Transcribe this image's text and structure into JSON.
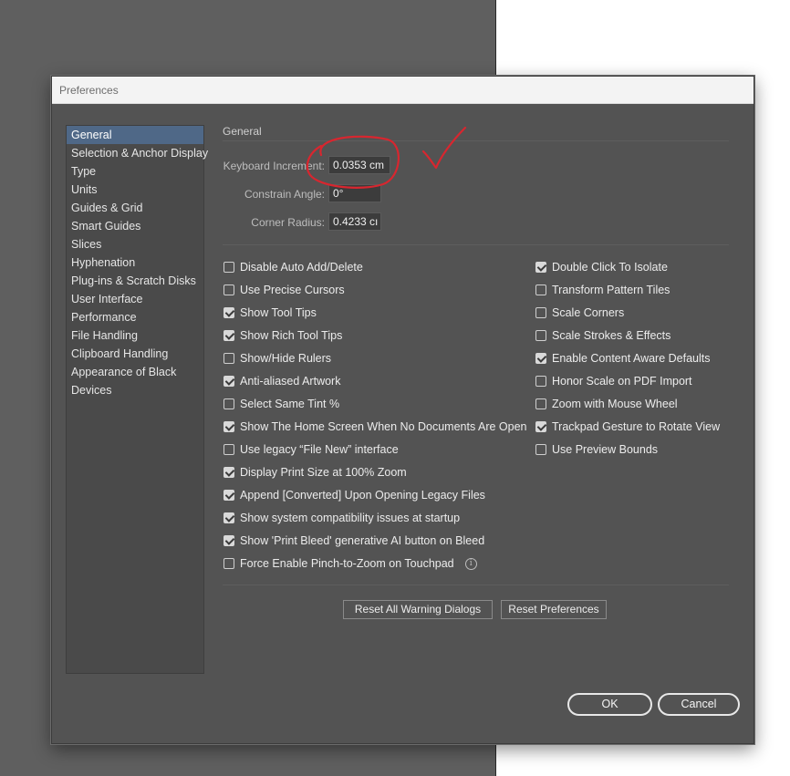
{
  "window": {
    "title": "Preferences"
  },
  "sidebar": {
    "items": [
      {
        "label": "General",
        "active": true
      },
      {
        "label": "Selection & Anchor Display"
      },
      {
        "label": "Type"
      },
      {
        "label": "Units"
      },
      {
        "label": "Guides & Grid"
      },
      {
        "label": "Smart Guides"
      },
      {
        "label": "Slices"
      },
      {
        "label": "Hyphenation"
      },
      {
        "label": "Plug-ins & Scratch Disks"
      },
      {
        "label": "User Interface"
      },
      {
        "label": "Performance"
      },
      {
        "label": "File Handling"
      },
      {
        "label": "Clipboard Handling"
      },
      {
        "label": "Appearance of Black"
      },
      {
        "label": "Devices"
      }
    ]
  },
  "general": {
    "section_title": "General",
    "keyboard_increment": {
      "label": "Keyboard Increment:",
      "value": "0.0353 cm"
    },
    "constrain_angle": {
      "label": "Constrain Angle:",
      "value": "0°"
    },
    "corner_radius": {
      "label": "Corner Radius:",
      "value": "0.4233 cı"
    }
  },
  "options_left": [
    {
      "label": "Disable Auto Add/Delete",
      "checked": false
    },
    {
      "label": "Use Precise Cursors",
      "checked": false
    },
    {
      "label": "Show Tool Tips",
      "checked": true
    },
    {
      "label": "Show Rich Tool Tips",
      "checked": true
    },
    {
      "label": "Show/Hide Rulers",
      "checked": false
    },
    {
      "label": "Anti-aliased Artwork",
      "checked": true
    },
    {
      "label": "Select Same Tint %",
      "checked": false
    },
    {
      "label": "Show The Home Screen When No Documents Are Open",
      "checked": true
    },
    {
      "label": "Use legacy “File New” interface",
      "checked": false
    },
    {
      "label": "Display Print Size at 100% Zoom",
      "checked": true
    },
    {
      "label": "Append [Converted] Upon Opening Legacy Files",
      "checked": true
    },
    {
      "label": "Show system compatibility issues at startup",
      "checked": true
    },
    {
      "label": "Show 'Print Bleed' generative AI button on Bleed",
      "checked": true
    },
    {
      "label": "Force Enable Pinch-to-Zoom on Touchpad",
      "checked": false,
      "info": "i"
    }
  ],
  "options_right": [
    {
      "label": "Double Click To Isolate",
      "checked": true
    },
    {
      "label": "Transform Pattern Tiles",
      "checked": false
    },
    {
      "label": "Scale Corners",
      "checked": false
    },
    {
      "label": "Scale Strokes & Effects",
      "checked": false
    },
    {
      "label": "Enable Content Aware Defaults",
      "checked": true
    },
    {
      "label": "Honor Scale on PDF Import",
      "checked": false
    },
    {
      "label": "Zoom with Mouse Wheel",
      "checked": false
    },
    {
      "label": "Trackpad Gesture to Rotate View",
      "checked": true
    },
    {
      "label": "Use Preview Bounds",
      "checked": false
    }
  ],
  "buttons": {
    "reset_warnings": "Reset All Warning Dialogs",
    "reset_preferences": "Reset Preferences",
    "ok": "OK",
    "cancel": "Cancel"
  },
  "annotation": {
    "color": "#d8262f",
    "shapes": [
      "circle-around-keyboard-increment",
      "checkmark"
    ]
  }
}
